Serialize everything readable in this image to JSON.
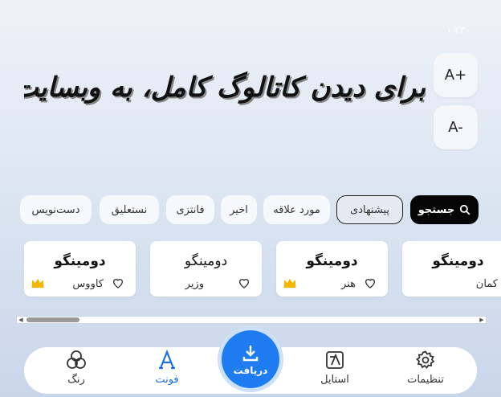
{
  "header": {
    "corner_label": "۱.۲۳"
  },
  "preview": {
    "text": "برای دیدن کاتالوگ کامل، به وبسایت ما سر بزنید"
  },
  "size_controls": {
    "increase_label": "A+",
    "decrease_label": "A-"
  },
  "filters": {
    "search_label": "جستجو",
    "items": [
      "پیشنهادی",
      "مورد علاقه",
      "اخیر",
      "فانتزی",
      "نستعلیق",
      "دست‌نویس"
    ],
    "active_index": 0
  },
  "fonts": [
    {
      "sample": "دومینگو",
      "name": "کمان",
      "premium": false
    },
    {
      "sample": "دومینگو",
      "name": "هنر",
      "premium": true
    },
    {
      "sample": "دومینگو",
      "name": "وزیر",
      "premium": false
    },
    {
      "sample": "دومینگو",
      "name": "کاووس",
      "premium": true
    }
  ],
  "nav": {
    "settings": "تنظیمات",
    "style": "استایل",
    "download": "دریافت",
    "font": "فونت",
    "color": "رنگ"
  },
  "colors": {
    "accent": "#1f7cf0",
    "active_nav": "#1f6fe0",
    "crown": "#f2b705",
    "search_chip": "#050505"
  }
}
